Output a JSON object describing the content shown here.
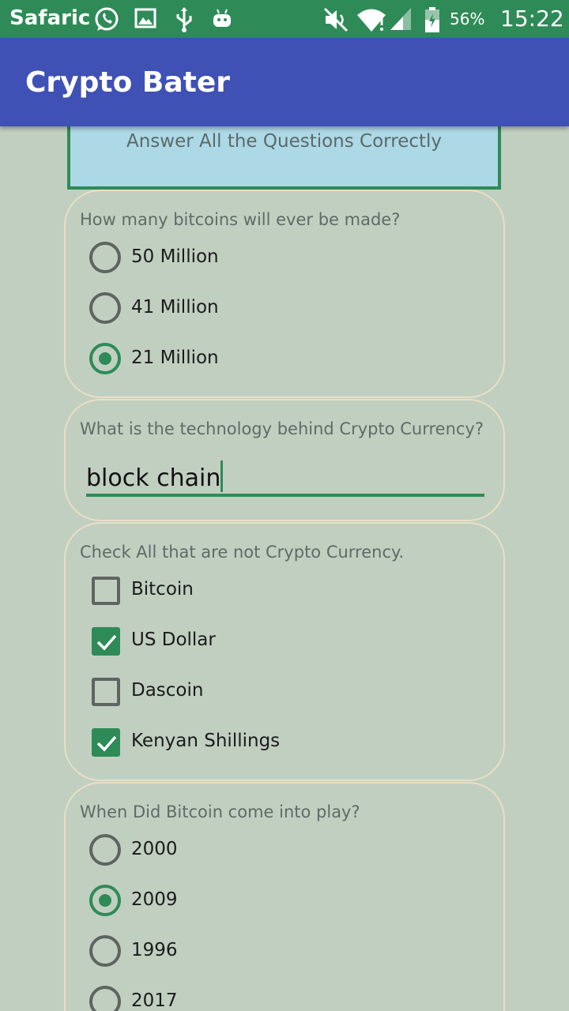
{
  "status_bar": {
    "carrier": "Safaricom",
    "battery": "56%",
    "time": "15:22"
  },
  "app_bar": {
    "title": "Crypto Bater"
  },
  "banner": {
    "text": "Answer All the Questions Correctly"
  },
  "questions": [
    {
      "type": "radio",
      "prompt": "How many bitcoins will ever be made?",
      "options": [
        {
          "label": "50 Million",
          "selected": false
        },
        {
          "label": "41 Million",
          "selected": false
        },
        {
          "label": "21 Million",
          "selected": true
        }
      ]
    },
    {
      "type": "text",
      "prompt": "What is the technology behind Crypto Currency?",
      "value": "block chain"
    },
    {
      "type": "checkbox",
      "prompt": "Check All that are not Crypto Currency.",
      "options": [
        {
          "label": "Bitcoin",
          "checked": false
        },
        {
          "label": "US Dollar",
          "checked": true
        },
        {
          "label": "Dascoin",
          "checked": false
        },
        {
          "label": "Kenyan Shillings",
          "checked": true
        }
      ]
    },
    {
      "type": "radio",
      "prompt": "When Did Bitcoin come into play?",
      "options": [
        {
          "label": "2000",
          "selected": false
        },
        {
          "label": "2009",
          "selected": true
        },
        {
          "label": "1996",
          "selected": false
        },
        {
          "label": "2017",
          "selected": false
        }
      ]
    }
  ],
  "colors": {
    "status_bar": "#2e8b57",
    "app_bar": "#3f51b5",
    "background": "#c1cfc1",
    "banner": "#add8e6",
    "accent": "#2e8b57"
  },
  "icons": [
    "whatsapp-icon",
    "image-icon",
    "usb-icon",
    "android-icon",
    "mute-icon",
    "wifi-icon",
    "signal-icon",
    "battery-icon"
  ]
}
